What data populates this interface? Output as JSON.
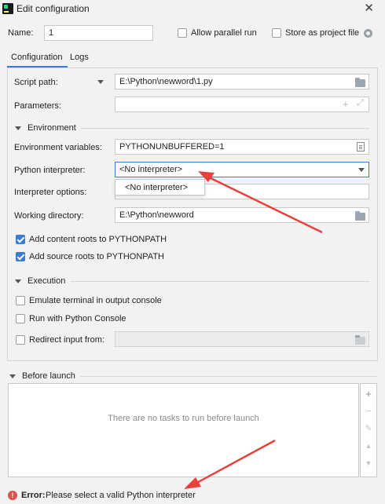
{
  "window": {
    "title": "Edit configuration",
    "close_icon": "close-icon"
  },
  "name_row": {
    "label": "Name:",
    "value": "1",
    "allow_parallel_label": "Allow parallel run",
    "allow_parallel_checked": false,
    "store_label": "Store as project file",
    "store_checked": false
  },
  "tabs": [
    {
      "label": "Configuration",
      "active": true
    },
    {
      "label": "Logs",
      "active": false
    }
  ],
  "config": {
    "script_path_label": "Script path:",
    "script_path_value": "E:\\Python\\newword\\1.py",
    "parameters_label": "Parameters:",
    "parameters_value": "",
    "environment_section": "Environment",
    "env_vars_label": "Environment variables:",
    "env_vars_value": "PYTHONUNBUFFERED=1",
    "interpreter_label": "Python interpreter:",
    "interpreter_value": "<No interpreter>",
    "interpreter_option": "<No interpreter>",
    "interp_options_label": "Interpreter options:",
    "working_dir_label": "Working directory:",
    "working_dir_value": "E:\\Python\\newword",
    "content_roots_label": "Add content roots to PYTHONPATH",
    "content_roots_checked": true,
    "source_roots_label": "Add source roots to PYTHONPATH",
    "source_roots_checked": true,
    "execution_section": "Execution",
    "emulate_label": "Emulate terminal in output console",
    "emulate_checked": false,
    "run_console_label": "Run with Python Console",
    "run_console_checked": false,
    "redirect_label": "Redirect input from:",
    "redirect_checked": false
  },
  "before_launch": {
    "label": "Before launch",
    "empty_text": "There are no tasks to run before launch",
    "buttons": [
      "+",
      "−",
      "✎",
      "▲",
      "▼"
    ]
  },
  "status": {
    "error_label": "Error:",
    "error_text": "Please select a valid Python interpreter"
  },
  "colors": {
    "accent": "#3a7bd5",
    "error": "#d9534f",
    "arrow": "#e8413c"
  }
}
